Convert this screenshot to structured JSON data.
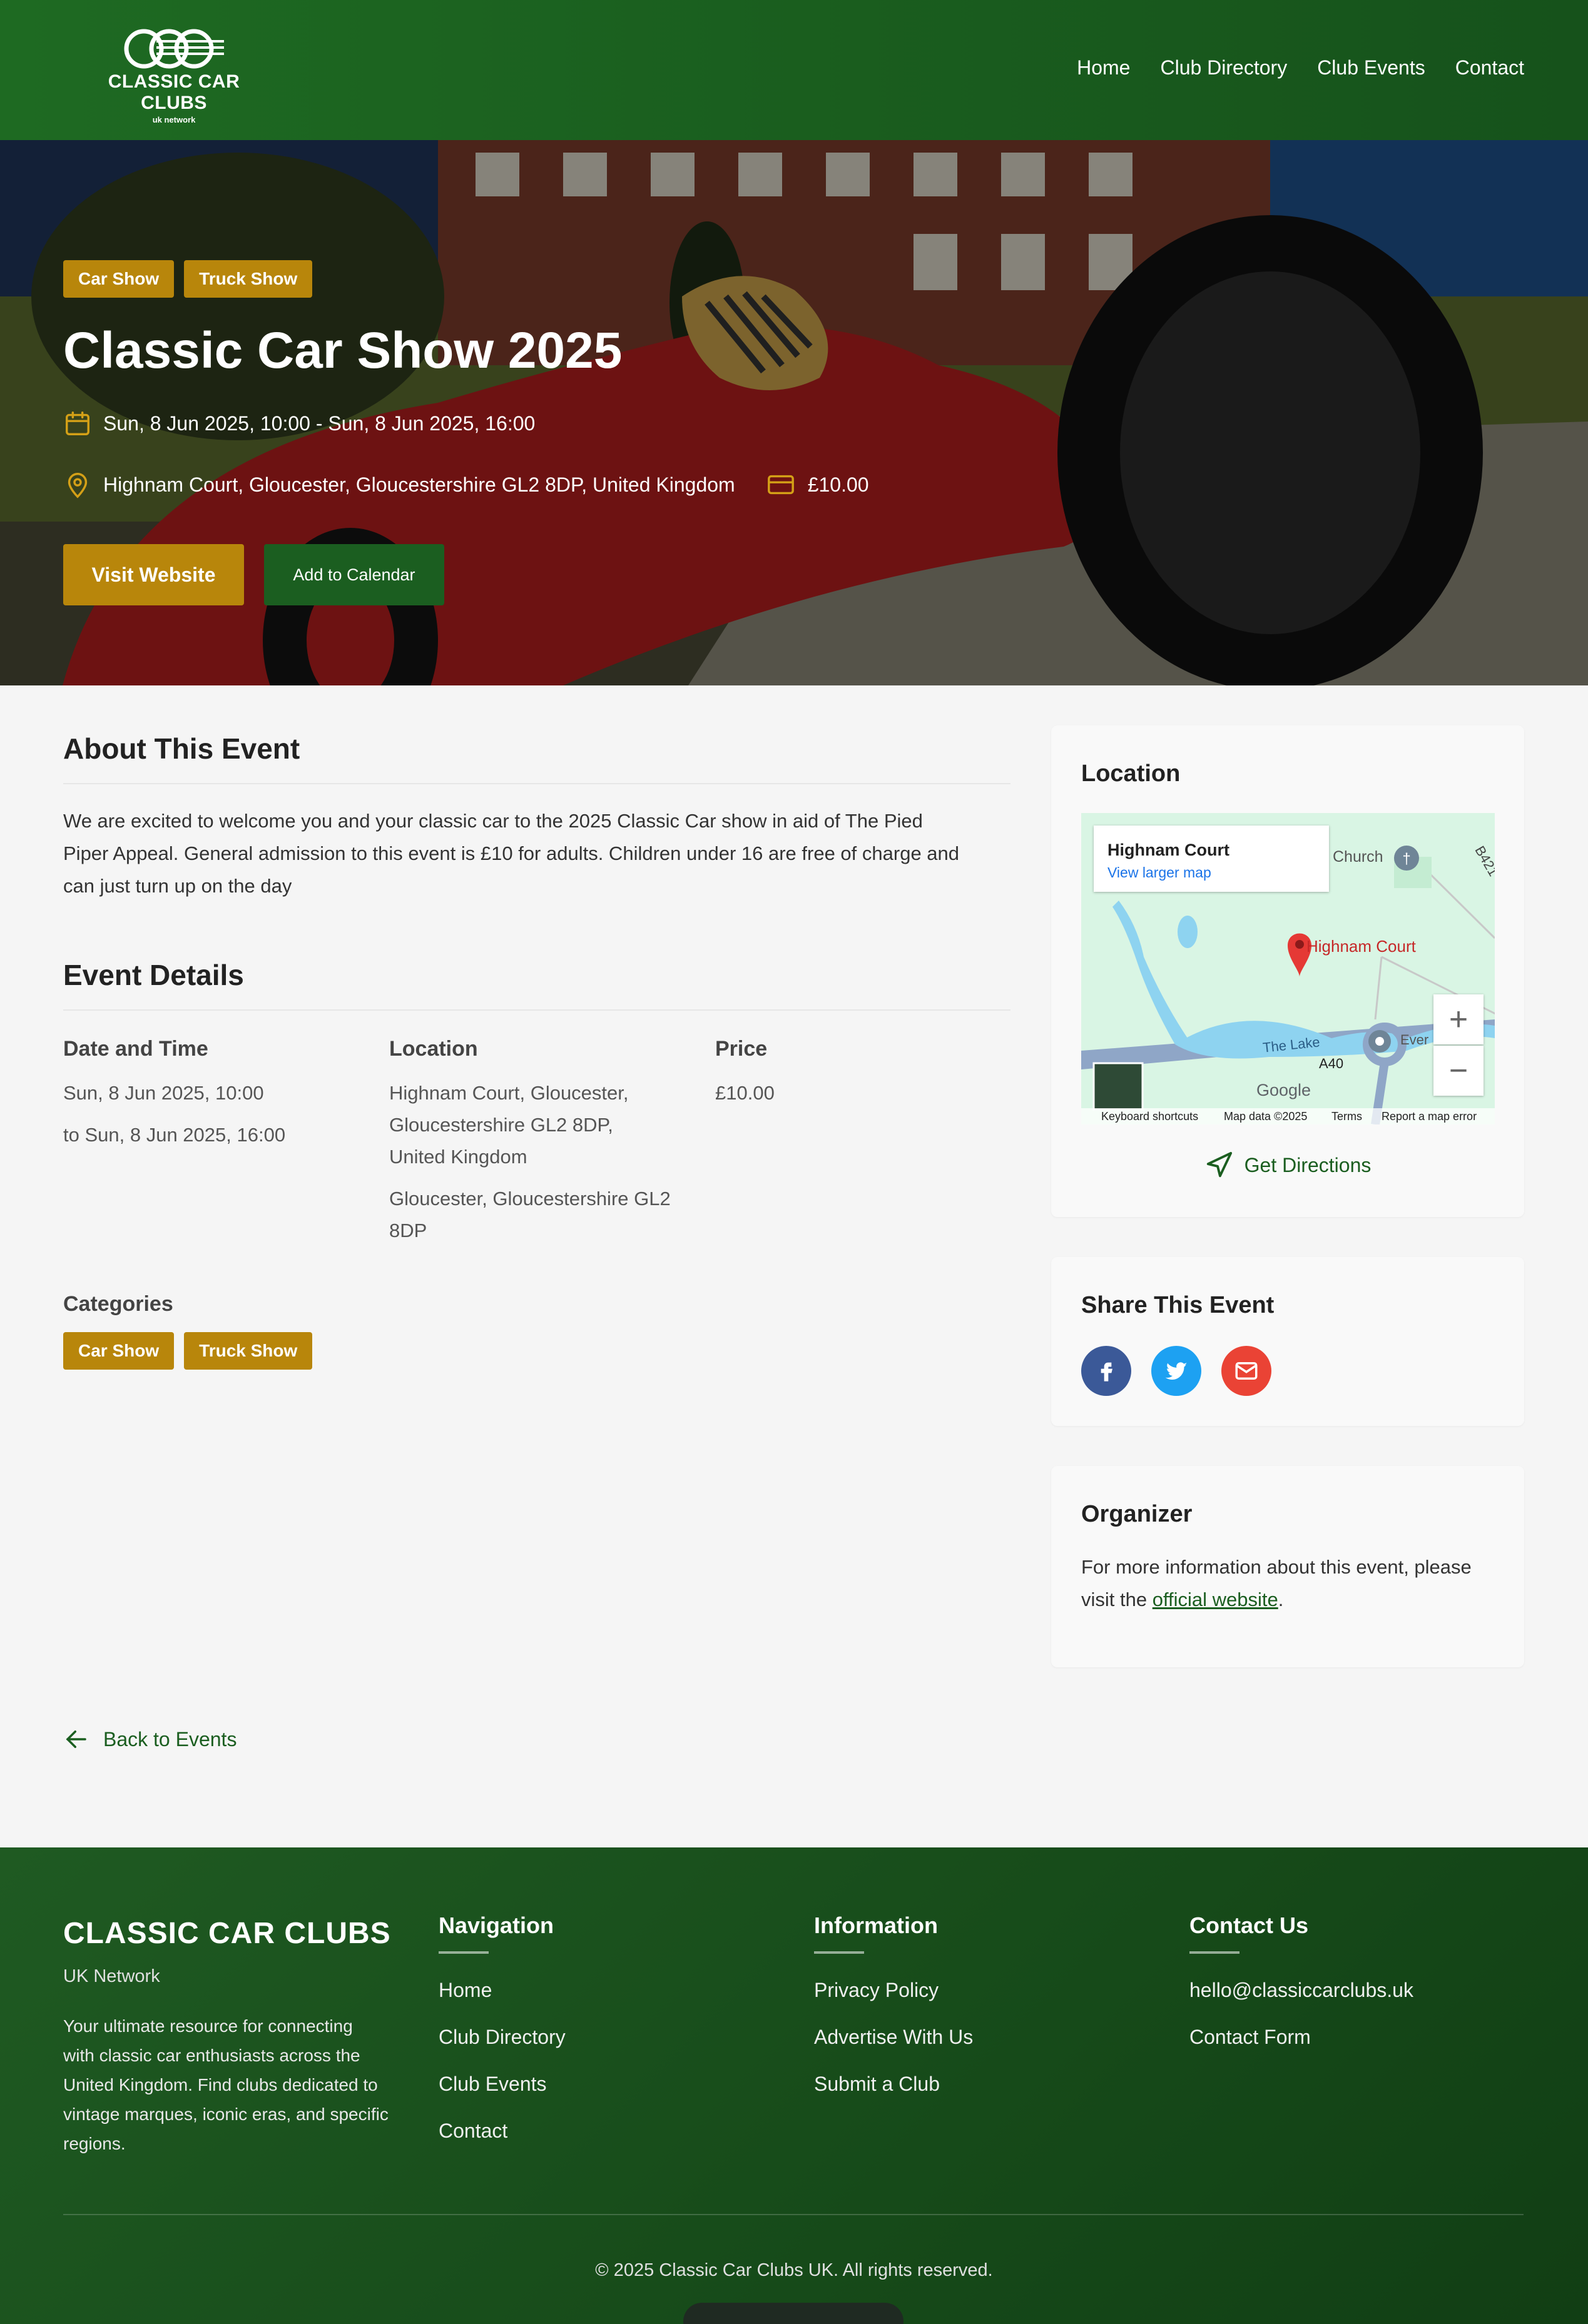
{
  "header": {
    "logo_title": "CLASSIC CAR CLUBS",
    "logo_sub": "uk network",
    "nav": [
      "Home",
      "Club Directory",
      "Club Events",
      "Contact"
    ]
  },
  "hero": {
    "tags": [
      "Car Show",
      "Truck Show"
    ],
    "title": "Classic Car Show 2025",
    "datetime": "Sun, 8 Jun 2025, 10:00  - Sun, 8 Jun 2025, 16:00",
    "address": "Highnam Court, Gloucester, Gloucestershire GL2 8DP, United Kingdom",
    "price": "£10.00",
    "visit_label": "Visit Website",
    "calendar_label": "Add to Calendar"
  },
  "about": {
    "heading": "About This Event",
    "lines": [
      "We are excited to welcome you and your classic car to the 2025 Classic Car show in aid of The Pied",
      "Piper Appeal. General admission to this event is £10 for adults. Children under 16 are free of charge and",
      "can just turn up on the day"
    ]
  },
  "details": {
    "heading": "Event Details",
    "date_h": "Date and Time",
    "date_lines": [
      "Sun, 8 Jun 2025, 10:00",
      "to Sun, 8 Jun 2025, 16:00"
    ],
    "loc_h": "Location",
    "loc_lines": [
      "Highnam Court, Gloucester,",
      "Gloucestershire GL2 8DP,",
      "United Kingdom"
    ],
    "loc_lines2": [
      "Gloucester, Gloucestershire GL2",
      "8DP"
    ],
    "price_h": "Price",
    "price": "£10.00",
    "categories_h": "Categories",
    "categories": [
      "Car Show",
      "Truck Show"
    ]
  },
  "sidebar": {
    "location_h": "Location",
    "map": {
      "place": "Highnam Court",
      "larger": "View larger map",
      "church": "Church",
      "pin_label": "Highnam Court",
      "lake": "The Lake",
      "road": "A40",
      "road2": "B421",
      "ever": "Ever",
      "google": "Google",
      "foot": [
        "Keyboard shortcuts",
        "Map data ©2025",
        "Terms",
        "Report a map error"
      ]
    },
    "directions": "Get Directions",
    "share_h": "Share This Event",
    "organizer_h": "Organizer",
    "organizer_text1": "For more information about this event, please",
    "organizer_text2": "visit the",
    "organizer_link": "official website",
    "organizer_end": "."
  },
  "back": "Back to Events",
  "footer": {
    "brand": "CLASSIC CAR CLUBS",
    "sub": "UK Network",
    "desc": "Your ultimate resource for connecting with classic car enthusiasts across the United Kingdom. Find clubs dedicated to vintage marques, iconic eras, and specific regions.",
    "nav_h": "Navigation",
    "nav": [
      "Home",
      "Club Directory",
      "Club Events",
      "Contact"
    ],
    "info_h": "Information",
    "info": [
      "Privacy Policy",
      "Advertise With Us",
      "Submit a Club"
    ],
    "contact_h": "Contact Us",
    "contact": [
      "hello@classiccarclubs.uk",
      "Contact Form"
    ],
    "copyright": "© 2025 Classic Car Clubs UK. All rights reserved."
  },
  "colors": {
    "brand_green": "#1b5e20",
    "accent_gold": "#b8860b",
    "facebook": "#3b5998",
    "twitter": "#1da1f2",
    "email": "#ea4335"
  }
}
